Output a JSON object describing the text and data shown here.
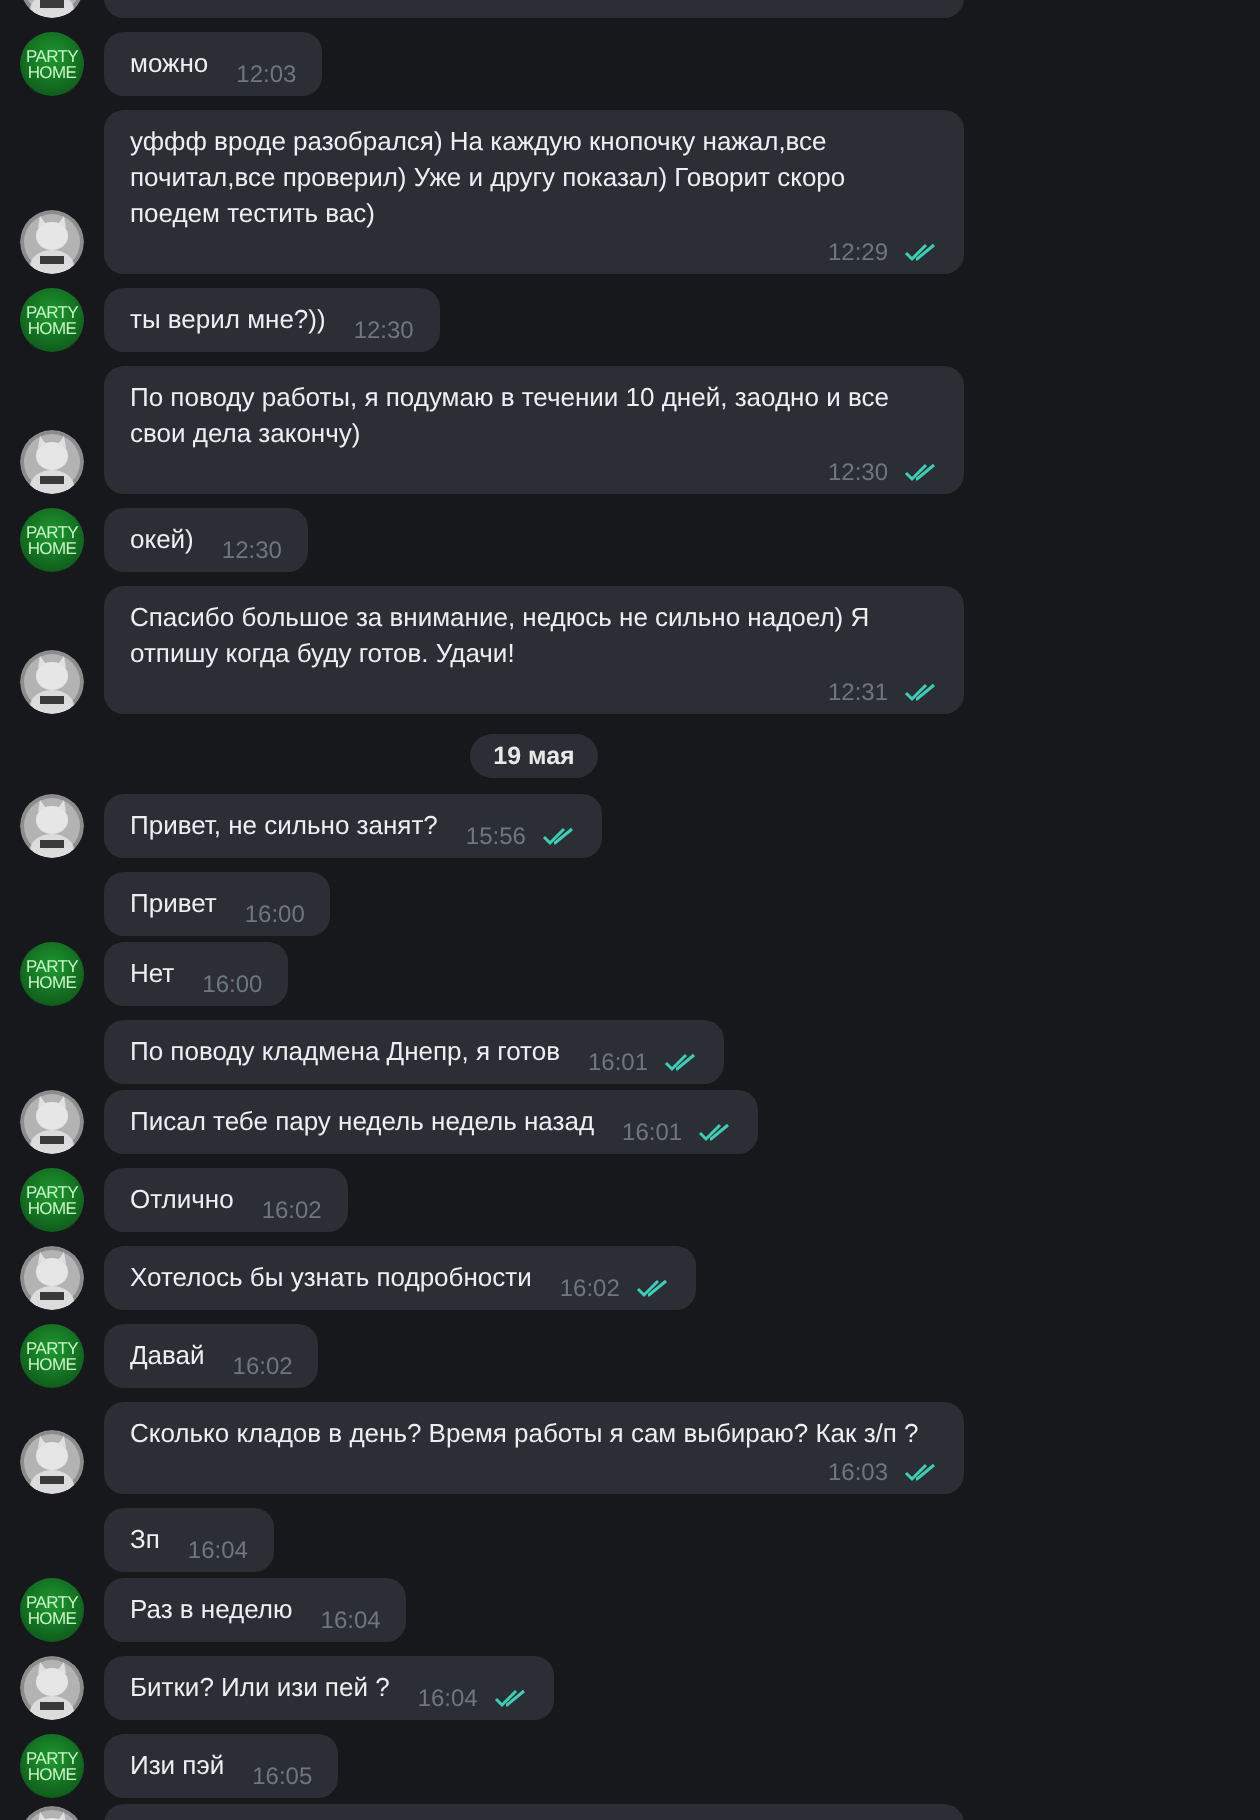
{
  "messages": [
    {
      "kind": "in",
      "text": "можно",
      "time": "12:03",
      "avatar": {
        "lines": [
          "PARTY",
          "HOME"
        ]
      }
    },
    {
      "kind": "out",
      "text": "уффф вроде разобрался) На каждую кнопочку нажал,все почитал,все проверил) Уже и другу показал) Говорит скоро поедем тестить вас)",
      "time": "12:29",
      "read": true
    },
    {
      "kind": "in",
      "text": "ты верил мне?))",
      "time": "12:30",
      "avatar": {
        "lines": [
          "PARTY",
          "HOME"
        ]
      }
    },
    {
      "kind": "out",
      "text": "По поводу работы, я подумаю в течении 10 дней, заодно и все свои дела закончу)",
      "time": "12:30",
      "read": true
    },
    {
      "kind": "in",
      "text": "окей)",
      "time": "12:30",
      "avatar": {
        "lines": [
          "PARTY",
          "HOME"
        ]
      }
    },
    {
      "kind": "out",
      "text": "Спасибо большое за внимание, недюсь не сильно надоел) Я отпишу когда буду готов. Удачи!",
      "time": "12:31",
      "read": true
    },
    {
      "kind": "date",
      "text": "19 мая"
    },
    {
      "kind": "out",
      "text": "Привет, не сильно занят?",
      "time": "15:56",
      "read": true
    },
    {
      "kind": "in",
      "text": "Привет",
      "time": "16:00"
    },
    {
      "kind": "in",
      "text": "Нет",
      "time": "16:00",
      "avatar": {
        "lines": [
          "PARTY",
          "HOME"
        ]
      }
    },
    {
      "kind": "out",
      "text": "По поводу кладмена Днепр, я готов",
      "time": "16:01",
      "read": true
    },
    {
      "kind": "out",
      "text": "Писал тебе пару недель недель назад",
      "time": "16:01",
      "read": true
    },
    {
      "kind": "in",
      "text": "Отлично",
      "time": "16:02",
      "avatar": {
        "lines": [
          "PARTY",
          "HOME"
        ]
      }
    },
    {
      "kind": "out",
      "text": "Хотелось бы узнать подробности",
      "time": "16:02",
      "read": true
    },
    {
      "kind": "in",
      "text": "Давай",
      "time": "16:02",
      "avatar": {
        "lines": [
          "PARTY",
          "HOME"
        ]
      }
    },
    {
      "kind": "out",
      "text": "Сколько кладов в день? Время работы я сам выбираю? Как з/п ?",
      "time": "16:03",
      "read": true
    },
    {
      "kind": "in",
      "text": "Зп",
      "time": "16:04"
    },
    {
      "kind": "in",
      "text": "Раз в неделю",
      "time": "16:04",
      "avatar": {
        "lines": [
          "PARTY",
          "HOME"
        ]
      }
    },
    {
      "kind": "out",
      "text": "Битки? Или изи пей ?",
      "time": "16:04",
      "read": true
    },
    {
      "kind": "in",
      "text": "Изи пэй",
      "time": "16:05",
      "avatar": {
        "lines": [
          "PARTY",
          "HOME"
        ]
      }
    }
  ]
}
